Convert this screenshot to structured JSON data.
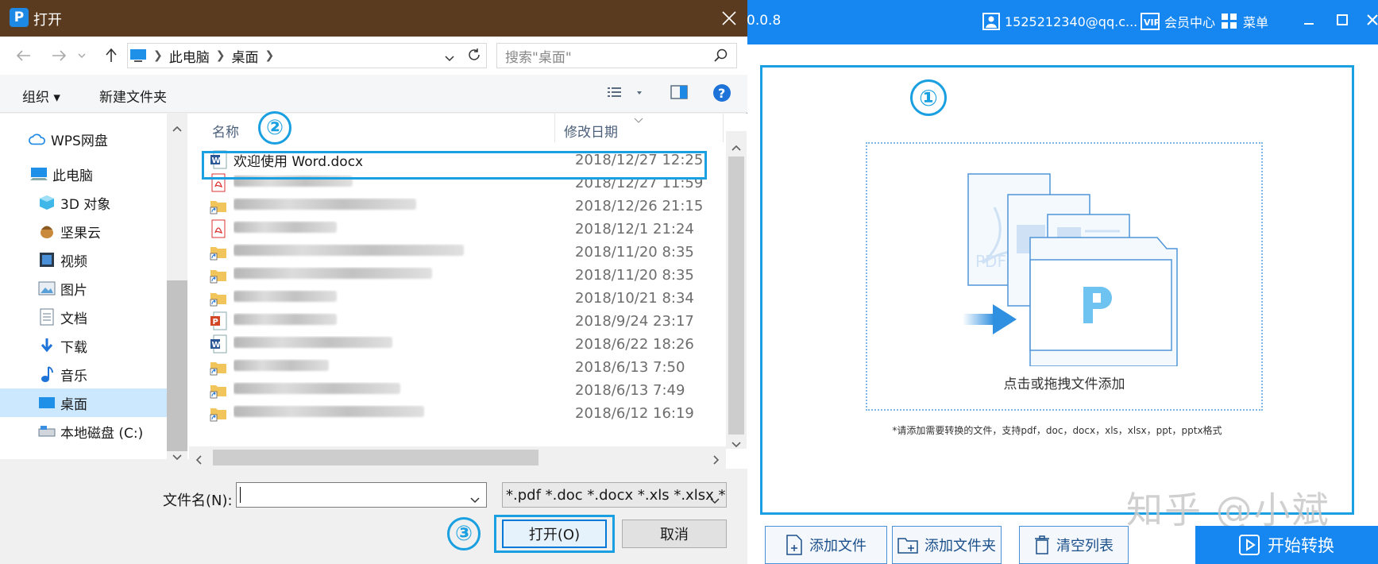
{
  "app": {
    "version": "0.0.8",
    "account": "1525212340@qq.c...",
    "vip_center": "会员中心",
    "menu": "菜单",
    "drop_hint": "点击或拖拽文件添加",
    "supported_note": "*请添加需要转换的文件，支持pdf，doc，docx，xls，xlsx，ppt，pptx格式",
    "buttons": {
      "add_file": "添加文件",
      "add_folder": "添加文件夹",
      "clear_list": "清空列表",
      "start": "开始转换"
    },
    "step1": "①",
    "accent": "#1687f0"
  },
  "watermark": "知乎 @小斌",
  "dialog": {
    "title": "打开",
    "breadcrumb": [
      "此电脑",
      "桌面"
    ],
    "search_placeholder": "搜索\"桌面\"",
    "organize": "组织 ▾",
    "new_folder": "新建文件夹",
    "nav_items": [
      {
        "label": "WPS网盘",
        "icon": "cloud-icon"
      },
      {
        "label": "此电脑",
        "icon": "computer-icon"
      },
      {
        "label": "3D 对象",
        "icon": "cube-icon"
      },
      {
        "label": "坚果云",
        "icon": "nut-icon"
      },
      {
        "label": "视频",
        "icon": "video-icon"
      },
      {
        "label": "图片",
        "icon": "picture-icon"
      },
      {
        "label": "文档",
        "icon": "document-icon"
      },
      {
        "label": "下载",
        "icon": "download-icon"
      },
      {
        "label": "音乐",
        "icon": "music-icon"
      },
      {
        "label": "桌面",
        "icon": "desktop-icon"
      },
      {
        "label": "本地磁盘 (C:)",
        "icon": "drive-icon"
      }
    ],
    "columns": {
      "name": "名称",
      "modified": "修改日期"
    },
    "step2": "②",
    "step3": "③",
    "files": [
      {
        "name": "欢迎使用 Word.docx",
        "date": "2018/12/27 12:25"
      },
      {
        "name": "",
        "date": "2018/12/27 11:59"
      },
      {
        "name": "",
        "date": "2018/12/26 21:15"
      },
      {
        "name": "",
        "date": "2018/12/1 21:24"
      },
      {
        "name": "",
        "date": "2018/11/20 8:35"
      },
      {
        "name": "",
        "date": "2018/11/20 8:35"
      },
      {
        "name": "",
        "date": "2018/10/21 8:34"
      },
      {
        "name": "",
        "date": "2018/9/24 23:17"
      },
      {
        "name": "",
        "date": "2018/6/22 18:26"
      },
      {
        "name": "",
        "date": "2018/6/13 7:50"
      },
      {
        "name": "",
        "date": "2018/6/13 7:49"
      },
      {
        "name": "",
        "date": "2018/6/12 16:19"
      }
    ],
    "filename_label": "文件名(N):",
    "filename_value": "",
    "filetype": "*.pdf *.doc *.docx *.xls *.xlsx *",
    "open_button": "打开(O)",
    "cancel_button": "取消"
  }
}
